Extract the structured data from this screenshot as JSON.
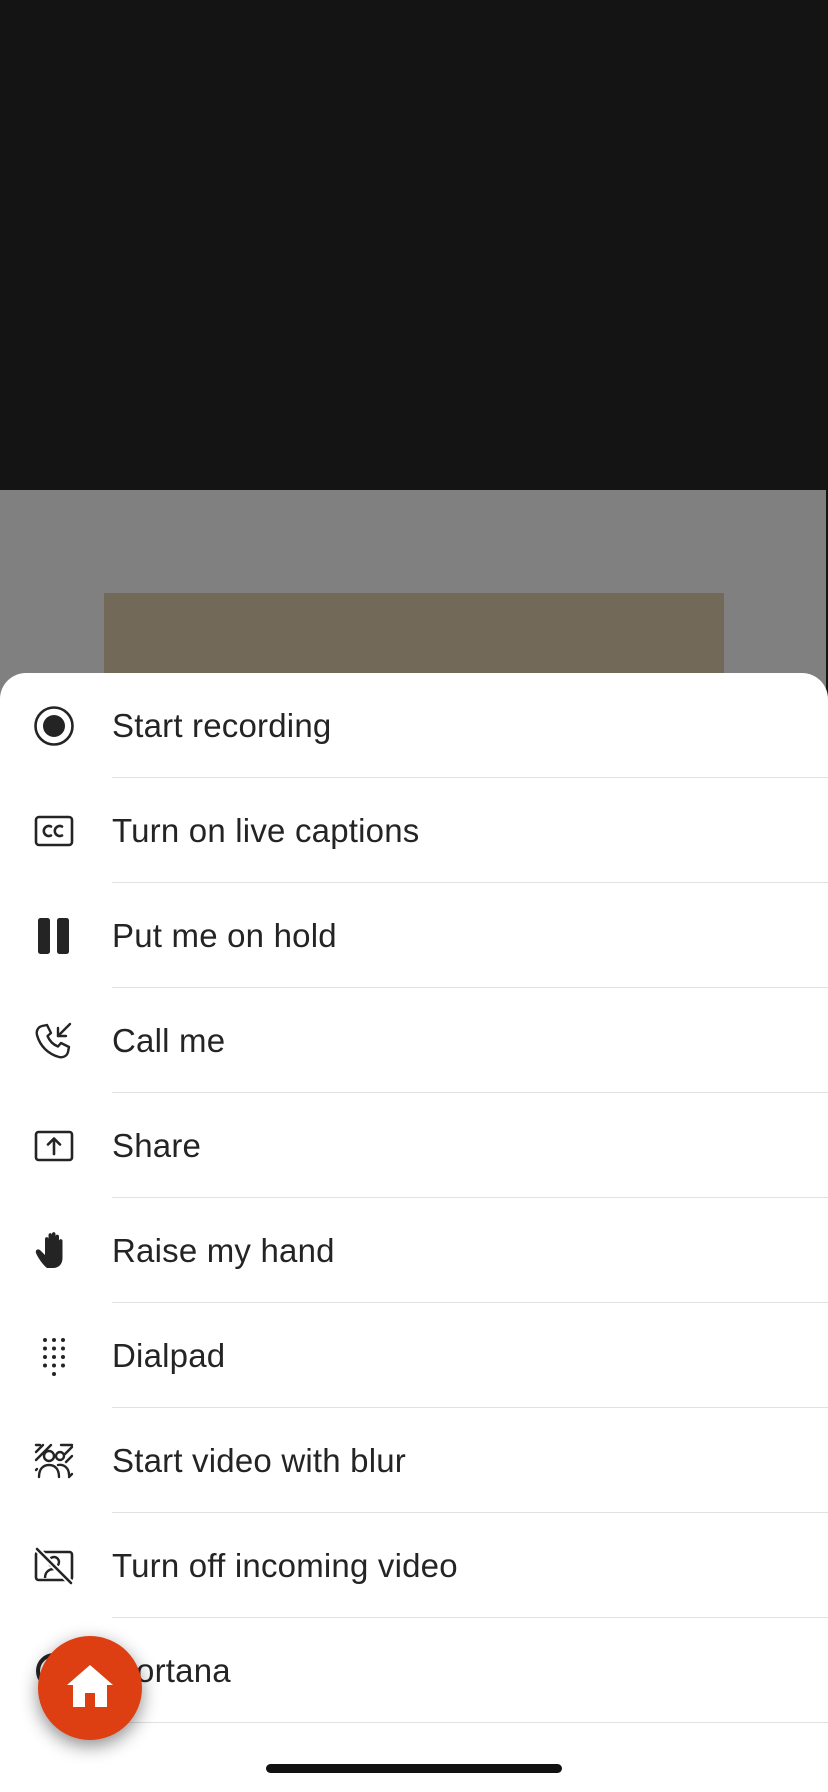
{
  "call_view": {
    "background_color": "#141414",
    "self_preview_color": "#808080"
  },
  "more_options_menu": {
    "items": [
      {
        "label": "Start recording",
        "icon": "record-icon"
      },
      {
        "label": "Turn on live captions",
        "icon": "closed-captions-icon"
      },
      {
        "label": "Put me on hold",
        "icon": "pause-icon"
      },
      {
        "label": "Call me",
        "icon": "phone-incoming-icon"
      },
      {
        "label": "Share",
        "icon": "share-screen-icon"
      },
      {
        "label": "Raise my hand",
        "icon": "hand-icon"
      },
      {
        "label": "Dialpad",
        "icon": "dialpad-icon"
      },
      {
        "label": "Start video with blur",
        "icon": "background-blur-icon"
      },
      {
        "label": "Turn off incoming video",
        "icon": "video-off-icon"
      },
      {
        "label": "Cortana",
        "icon": "cortana-icon"
      }
    ]
  },
  "home_button": {
    "icon": "home-icon",
    "color": "#dd3f13"
  }
}
